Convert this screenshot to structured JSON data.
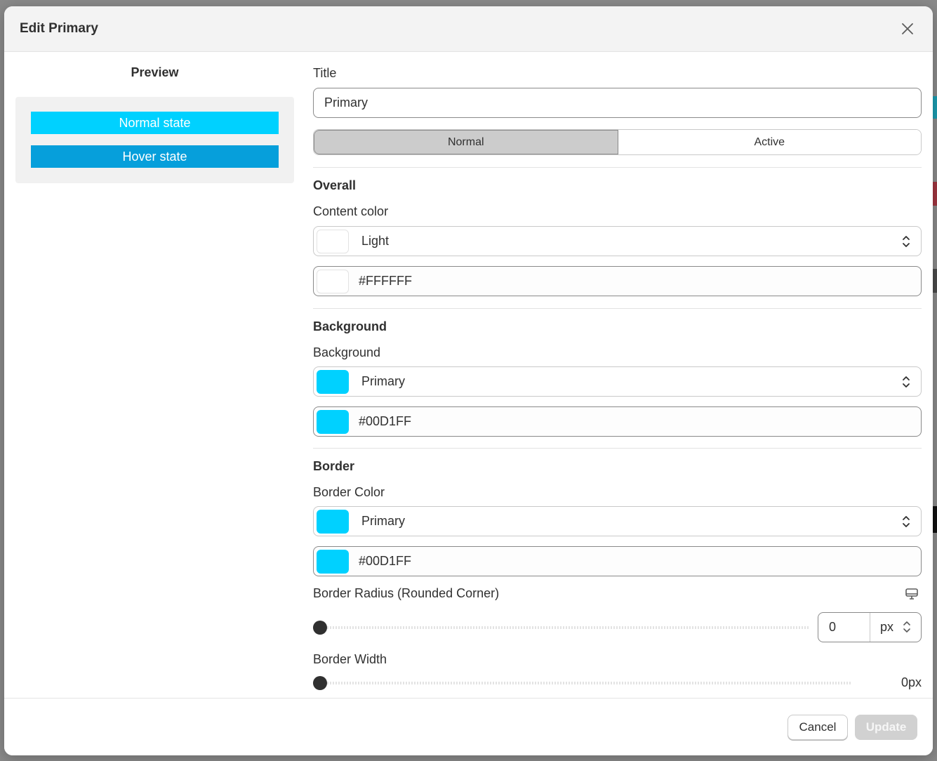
{
  "modal": {
    "title": "Edit Primary",
    "close_icon": "close-icon"
  },
  "preview": {
    "title": "Preview",
    "normal_label": "Normal state",
    "hover_label": "Hover state",
    "normal_color": "#00D1FF",
    "hover_color": "#069FDB"
  },
  "form": {
    "title_label": "Title",
    "title_value": "Primary",
    "tabs": [
      {
        "label": "Normal",
        "selected": true
      },
      {
        "label": "Active",
        "selected": false
      }
    ],
    "overall": {
      "section": "Overall",
      "content_color_label": "Content color",
      "content_color_preset": "Light",
      "content_color_hex": "#FFFFFF"
    },
    "background": {
      "section": "Background",
      "label": "Background",
      "preset": "Primary",
      "hex": "#00D1FF"
    },
    "border": {
      "section": "Border",
      "color_label": "Border Color",
      "color_preset": "Primary",
      "color_hex": "#00D1FF",
      "radius_label": "Border Radius (Rounded Corner)",
      "radius_value": "0",
      "radius_unit": "px",
      "device_icon": "desktop-icon",
      "width_label": "Border Width",
      "width_value": "0px"
    }
  },
  "footer": {
    "cancel_label": "Cancel",
    "update_label": "Update"
  }
}
